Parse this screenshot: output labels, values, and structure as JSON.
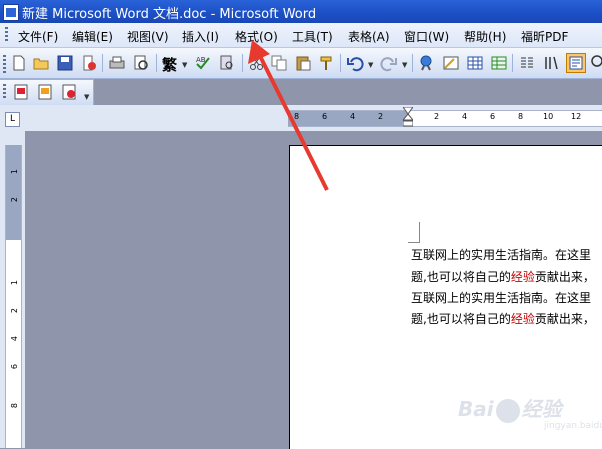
{
  "window": {
    "title": "新建 Microsoft Word 文档.doc - Microsoft Word"
  },
  "menu": {
    "items": [
      {
        "label": "文件(F)"
      },
      {
        "label": "编辑(E)"
      },
      {
        "label": "视图(V)"
      },
      {
        "label": "插入(I)"
      },
      {
        "label": "格式(O)"
      },
      {
        "label": "工具(T)"
      },
      {
        "label": "表格(A)"
      },
      {
        "label": "窗口(W)"
      },
      {
        "label": "帮助(H)"
      },
      {
        "label": "福昕PDF"
      }
    ]
  },
  "toolbar": {
    "traditional_label": "繁"
  },
  "ruler": {
    "horizontal_numbers": [
      "8",
      "6",
      "4",
      "2",
      "2",
      "4",
      "6",
      "8",
      "10",
      "12"
    ],
    "vertical_numbers": [
      "1",
      "2",
      "1",
      "2",
      "4",
      "6",
      "8"
    ],
    "corner_symbol": "L"
  },
  "document": {
    "lines": [
      {
        "text": "互联网上的实用生活指南。在这里"
      },
      {
        "pre": "题,也可以将自己的",
        "highlight": "经验",
        "post": "贡献出来，"
      },
      {
        "text": "互联网上的实用生活指南。在这里"
      },
      {
        "pre": "题,也可以将自己的",
        "highlight": "经验",
        "post": "贡献出来，"
      }
    ],
    "highlight_color": "#c00000"
  },
  "annotation": {
    "arrow_color": "#e8392e"
  },
  "watermark": {
    "text": "Bai",
    "text2": "经验",
    "sub": "jingyan.baidu.com"
  }
}
